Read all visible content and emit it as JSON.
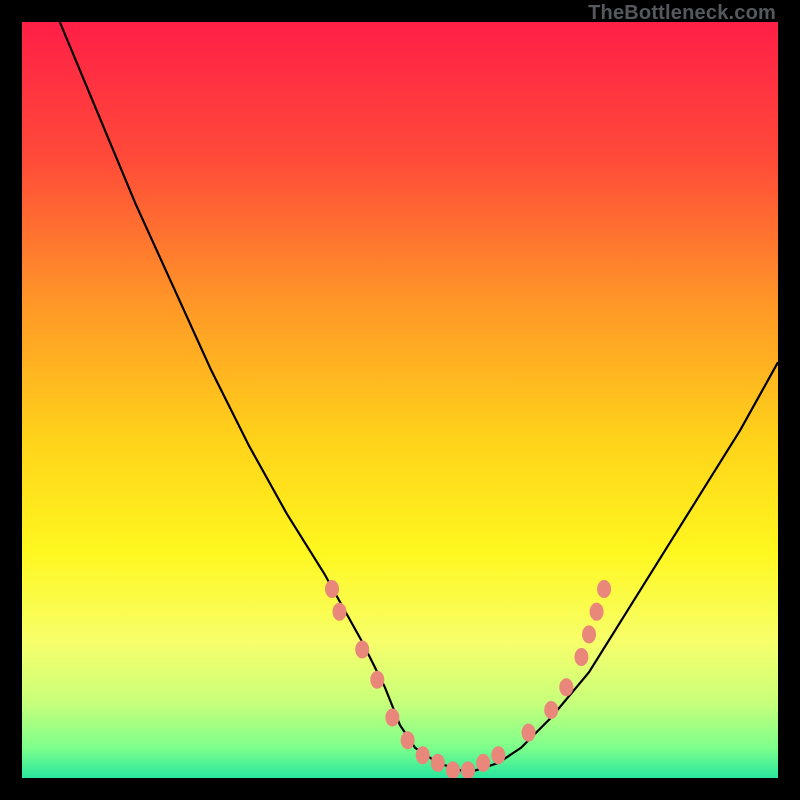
{
  "watermark": "TheBottleneck.com",
  "chart_data": {
    "type": "line",
    "title": "",
    "xlabel": "",
    "ylabel": "",
    "xlim": [
      0,
      100
    ],
    "ylim": [
      0,
      100
    ],
    "grid": false,
    "background_gradient": {
      "stops": [
        {
          "pos": 0.0,
          "color": "#ff1f47"
        },
        {
          "pos": 0.18,
          "color": "#ff4a39"
        },
        {
          "pos": 0.38,
          "color": "#ff9a26"
        },
        {
          "pos": 0.55,
          "color": "#ffd21a"
        },
        {
          "pos": 0.7,
          "color": "#fff71f"
        },
        {
          "pos": 0.82,
          "color": "#f7ff6a"
        },
        {
          "pos": 0.9,
          "color": "#c8ff7a"
        },
        {
          "pos": 0.96,
          "color": "#7dff8c"
        },
        {
          "pos": 1.0,
          "color": "#28e69d"
        }
      ]
    },
    "series": [
      {
        "name": "bottleneck-curve",
        "color": "#000000",
        "x": [
          5,
          10,
          15,
          20,
          25,
          30,
          35,
          40,
          45,
          48,
          50,
          52,
          55,
          58,
          60,
          63,
          66,
          70,
          75,
          80,
          85,
          90,
          95,
          100
        ],
        "y": [
          100,
          88,
          76,
          65,
          54,
          44,
          35,
          27,
          18,
          12,
          7,
          4,
          2,
          1,
          1,
          2,
          4,
          8,
          14,
          22,
          30,
          38,
          46,
          55
        ]
      }
    ],
    "markers": {
      "name": "highlighted-points",
      "color": "#e9877a",
      "points": [
        {
          "x": 41,
          "y": 25
        },
        {
          "x": 42,
          "y": 22
        },
        {
          "x": 45,
          "y": 17
        },
        {
          "x": 47,
          "y": 13
        },
        {
          "x": 49,
          "y": 8
        },
        {
          "x": 51,
          "y": 5
        },
        {
          "x": 53,
          "y": 3
        },
        {
          "x": 55,
          "y": 2
        },
        {
          "x": 57,
          "y": 1
        },
        {
          "x": 59,
          "y": 1
        },
        {
          "x": 61,
          "y": 2
        },
        {
          "x": 63,
          "y": 3
        },
        {
          "x": 67,
          "y": 6
        },
        {
          "x": 70,
          "y": 9
        },
        {
          "x": 72,
          "y": 12
        },
        {
          "x": 74,
          "y": 16
        },
        {
          "x": 75,
          "y": 19
        },
        {
          "x": 76,
          "y": 22
        },
        {
          "x": 77,
          "y": 25
        }
      ]
    }
  }
}
